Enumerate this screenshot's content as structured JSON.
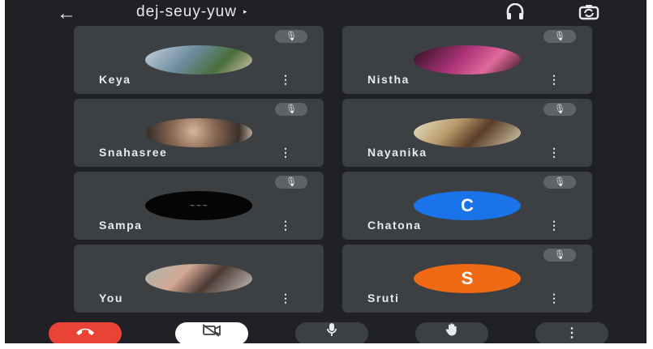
{
  "meeting": {
    "code": "dej-seuy-yuw",
    "caret": "▸"
  },
  "icons": {
    "back": "←",
    "audio": "🎧",
    "camera_switch": "⟲",
    "mic_off": "🎙",
    "more": "⋮",
    "hangup": "☎",
    "camera_off": "⊘",
    "mic": "🎤",
    "hand": "✋"
  },
  "participants": [
    {
      "name": "Keya",
      "avatar_color": "#8aa4b5",
      "initial": ""
    },
    {
      "name": "Nistha",
      "avatar_color": "#9b2f6a",
      "initial": ""
    },
    {
      "name": "Snahasree",
      "avatar_color": "#7a6454",
      "initial": ""
    },
    {
      "name": "Nayanika",
      "avatar_color": "#b5a58a",
      "initial": ""
    },
    {
      "name": "Sampa",
      "avatar_color": "#050505",
      "initial": ""
    },
    {
      "name": "Chatona",
      "avatar_color": "#1a73e8",
      "initial": "C"
    },
    {
      "name": "You",
      "avatar_color": "#7c8f8d",
      "initial": ""
    },
    {
      "name": "Sruti",
      "avatar_color": "#f06a16",
      "initial": "S"
    }
  ],
  "colors": {
    "hangup": "#ea4335",
    "camera_off_bg": "#ffffff",
    "control_bg": "#3c4043"
  }
}
